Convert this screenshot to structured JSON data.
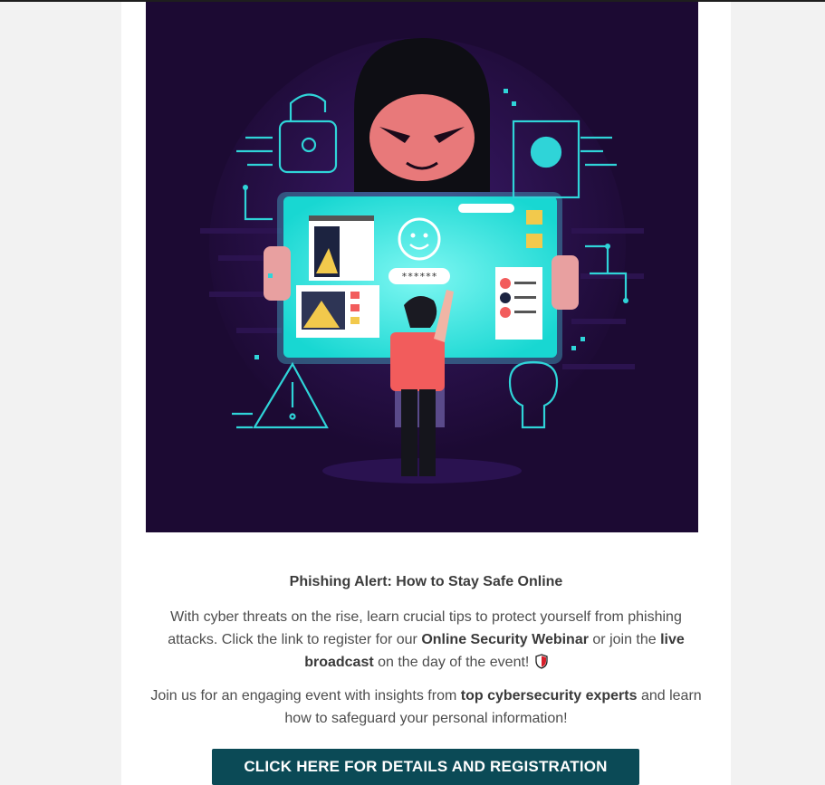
{
  "hero": {
    "image": "phishing-hacker-illustration",
    "password_text": "******"
  },
  "article": {
    "title": "Phishing Alert: How to Stay Safe Online",
    "p1": {
      "t1": "With cyber threats on the rise, learn crucial tips to protect yourself from phishing attacks. Click the link to register for our ",
      "b1": "Online Security Webinar",
      "t2": " or join the ",
      "b2": "live broadcast",
      "t3": " on the day of the event! "
    },
    "p2": {
      "t1": "Join us for an engaging event with insights from ",
      "b1": "top cybersecurity experts",
      "t2": " and learn how to safeguard your personal information!"
    },
    "cta_label": "CLICK HERE FOR DETAILS AND REGISTRATION"
  },
  "colors": {
    "button": "#0b4a56",
    "hero_bg": "#1c0a33",
    "screen": "#2ee6e0",
    "accent": "#f25c5c"
  }
}
